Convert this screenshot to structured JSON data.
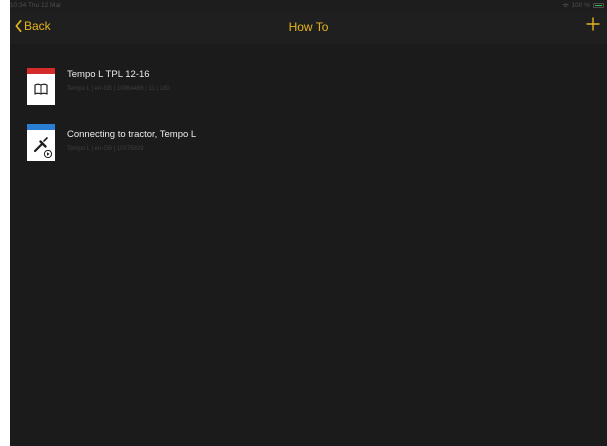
{
  "status_bar": {
    "time": "10:34",
    "date": "Thu 12 Mar",
    "battery": "100 %",
    "battery_level": 1.0
  },
  "nav": {
    "back_label": "Back",
    "title": "How To",
    "add_icon": "plus-icon"
  },
  "colors": {
    "accent": "#e5b31d",
    "background": "#1b1b1b",
    "navbar": "#1f1f1f"
  },
  "documents": [
    {
      "title": "Tempo L TPL 12-16",
      "meta": "Tempo L | en-GB | 10064488 | 11 | 180",
      "band_color": "#d62b2b",
      "icon": "book-icon"
    },
    {
      "title": "Connecting to tractor, Tempo L",
      "meta": "Tempo L | en-GB | 10076829",
      "band_color": "#2a7fd4",
      "icon": "video-tool-icon"
    }
  ]
}
